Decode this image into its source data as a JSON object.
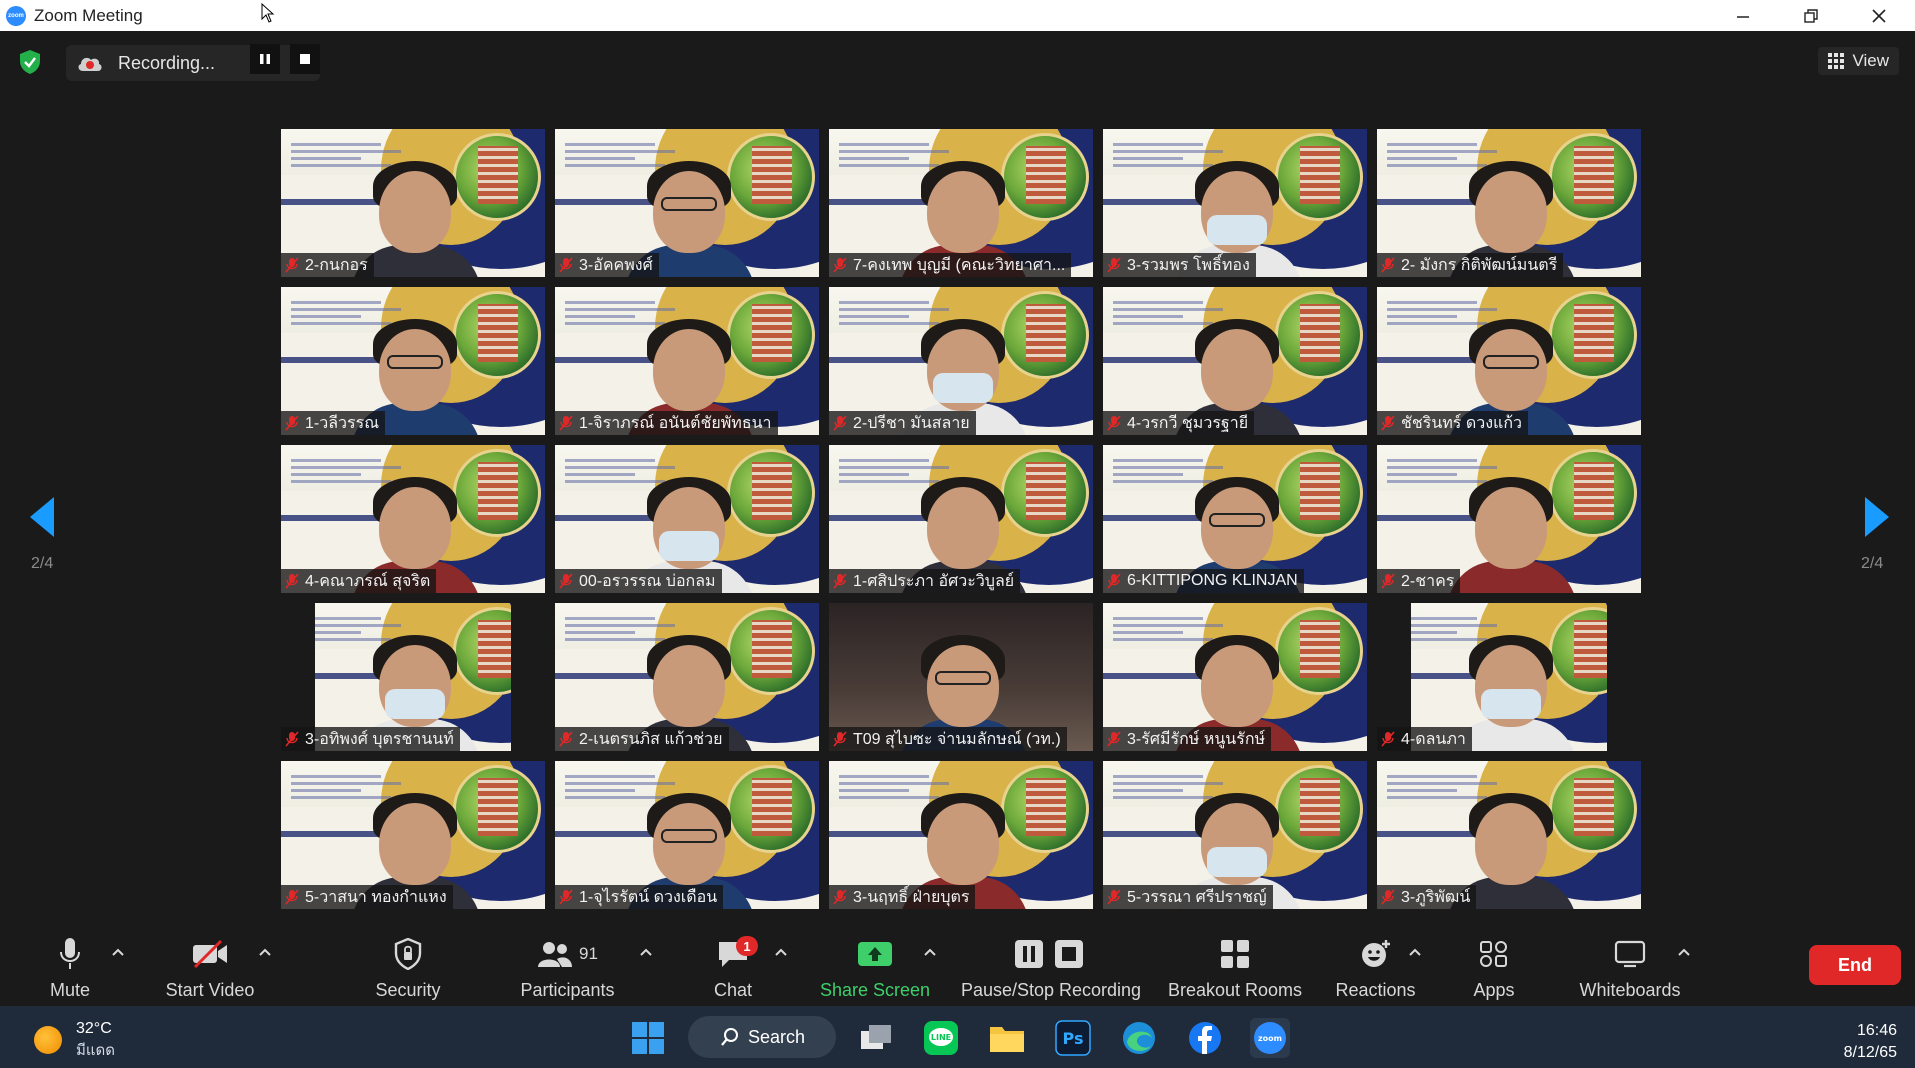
{
  "window": {
    "title": "Zoom Meeting"
  },
  "topbar": {
    "recording_label": "Recording...",
    "view_label": "View"
  },
  "gallery": {
    "page_indicator_left": "2/4",
    "page_indicator_right": "2/4",
    "participants": [
      {
        "name": "2-กนกอร",
        "style": "slide"
      },
      {
        "name": "3-อัคคพงศ์",
        "style": "slide"
      },
      {
        "name": "7-คงเทพ บุญมี (คณะวิทยาศา...",
        "style": "slide"
      },
      {
        "name": "3-รวมพร โพธิ์ทอง",
        "style": "slide"
      },
      {
        "name": "2- มังกร กิติพัฒน์มนตรี",
        "style": "slide"
      },
      {
        "name": "1-วลีวรรณ",
        "style": "slide"
      },
      {
        "name": "1-จิราภรณ์ อนันต์ชัยพัทธนา",
        "style": "slide"
      },
      {
        "name": "2-ปรีชา  มันสลาย",
        "style": "slide"
      },
      {
        "name": "4-วรกวี ชุมวรฐายี",
        "style": "slide"
      },
      {
        "name": "ชัชรินทร์  ดวงแก้ว",
        "style": "slide"
      },
      {
        "name": "4-คณาภรณ์ สุจริต",
        "style": "slide"
      },
      {
        "name": "00-อรวรรณ บ่อกลม",
        "style": "slide"
      },
      {
        "name": "1-ศสิประภา อัศวะวิบูลย์",
        "style": "slide"
      },
      {
        "name": "6-KITTIPONG KLINJAN",
        "style": "slide"
      },
      {
        "name": "2-ชาคร",
        "style": "slide"
      },
      {
        "name": "3-อทิพงศ์ บุตรชานนท์",
        "style": "pillar"
      },
      {
        "name": "2-เนตรนภิส แก้วช่วย",
        "style": "slide"
      },
      {
        "name": "T09 สุไบซะ จ่านมลักษณ์ (วท.)",
        "style": "dark"
      },
      {
        "name": "3-รัศมีรักษ์ หนูนรักษ์",
        "style": "slide"
      },
      {
        "name": "4-ดลนภา",
        "style": "pillar"
      },
      {
        "name": "5-วาสนา ทองกำแหง",
        "style": "slide"
      },
      {
        "name": "1-จุไรรัตน์ ดวงเดือน",
        "style": "slide"
      },
      {
        "name": "3-นฤทธิ์ ฝ่ายบุตร",
        "style": "slide"
      },
      {
        "name": "5-วรรณา ศรีปราชญ์",
        "style": "slide"
      },
      {
        "name": "3-ภูริพัฒน์",
        "style": "slide"
      }
    ]
  },
  "toolbar": {
    "mute": "Mute",
    "start_video": "Start Video",
    "security": "Security",
    "participants": "Participants",
    "participants_count": "91",
    "chat": "Chat",
    "chat_badge": "1",
    "share_screen": "Share Screen",
    "pause_stop_recording": "Pause/Stop Recording",
    "breakout_rooms": "Breakout Rooms",
    "reactions": "Reactions",
    "apps": "Apps",
    "whiteboards": "Whiteboards",
    "end": "End"
  },
  "taskbar": {
    "temperature": "32°C",
    "weather_text": "มีแดด",
    "search_label": "Search",
    "time": "16:46",
    "date": "8/12/65"
  },
  "colors": {
    "share_green": "#3ecf6b",
    "end_red": "#e02828",
    "zoom_blue": "#2d8cff",
    "arrow_blue": "#1a9bff"
  }
}
